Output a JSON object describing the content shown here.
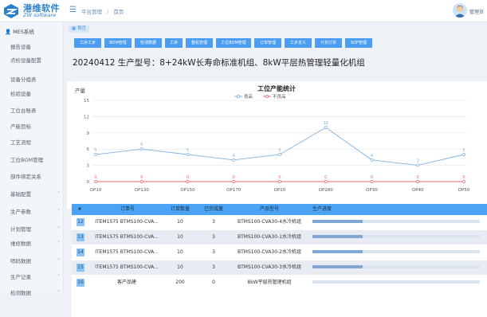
{
  "brand": {
    "name": "港维软件",
    "sub": "ZW software",
    "accent": "#2b7fd0"
  },
  "topbar": {
    "menu_icon": "menu-icon",
    "breadcrumbs": [
      "平台管理",
      "首页"
    ],
    "user_name": "管理员"
  },
  "sidebar": {
    "header": "MES系统",
    "items": [
      {
        "label": "报告设备",
        "expandable": false
      },
      {
        "label": "点检设备配置",
        "expandable": false
      },
      {
        "label": "设备分组表",
        "expandable": false
      },
      {
        "label": "检验设备",
        "expandable": false
      },
      {
        "label": "工位台账表",
        "expandable": false
      },
      {
        "label": "产能目标",
        "expandable": false
      },
      {
        "label": "工艺流程",
        "expandable": false
      },
      {
        "label": "工位BOM管理",
        "expandable": false
      },
      {
        "label": "部件绑定关系",
        "expandable": false
      },
      {
        "label": "基础配置",
        "expandable": true
      },
      {
        "label": "生产参数",
        "expandable": true
      },
      {
        "label": "计划管理",
        "expandable": true
      },
      {
        "label": "维修数据",
        "expandable": true
      },
      {
        "label": "喷码数据",
        "expandable": true
      },
      {
        "label": "生产记录",
        "expandable": true
      },
      {
        "label": "检测数据",
        "expandable": true
      }
    ]
  },
  "main": {
    "tab_tag": "首页",
    "buttons": [
      "工序工步",
      "BOM管理",
      "检测数据",
      "工序",
      "整机管理",
      "工位BOM管理",
      "订单管理",
      "工步定义",
      "计划订单",
      "SOP管理"
    ],
    "title": "20240412 生产型号：8+24kW长寿命标准机组、8kW平层热管理轻量化机组"
  },
  "chart_data": {
    "type": "line",
    "title": "工位产能统计",
    "ylabel": "产量",
    "xlabel": "",
    "ylim": [
      0,
      15
    ],
    "yticks": [
      0,
      3,
      6,
      9,
      12,
      15
    ],
    "categories": [
      "OP10",
      "OP130",
      "OP150",
      "OP170",
      "OP20",
      "OP280",
      "OP30",
      "OP40",
      "OP50"
    ],
    "series": [
      {
        "name": "良品",
        "color": "#7fb3e0",
        "values": [
          5,
          6,
          5,
          4,
          5,
          10,
          4,
          3,
          5
        ]
      },
      {
        "name": "不良品",
        "color": "#e86a6a",
        "values": [
          0,
          0,
          0,
          0,
          0,
          0,
          0,
          0,
          0
        ]
      }
    ],
    "legend": "top-center",
    "grid": true
  },
  "table": {
    "headers": [
      "#",
      "订单号",
      "订单数量",
      "已完成量",
      "产品型号",
      "生产进度"
    ],
    "rows": [
      {
        "idx": "12",
        "order": "ITEM1575 BTMS100-CVA...",
        "qty": "10",
        "done": "3",
        "model": "BTMS100-CVA30-4水冷机组",
        "progress": 0.3
      },
      {
        "idx": "13",
        "order": "ITEM1575 BTMS100-CVA...",
        "qty": "10",
        "done": "3",
        "model": "BTMS100-CVA30-1水冷机组",
        "progress": 0.3
      },
      {
        "idx": "14",
        "order": "ITEM1575 BTMS100-CVA...",
        "qty": "10",
        "done": "3",
        "model": "BTMS100-CVA30-2水冷机组",
        "progress": 0.3
      },
      {
        "idx": "15",
        "order": "ITEM1575 BTMS100-CVA...",
        "qty": "10",
        "done": "3",
        "model": "BTMS100-CVA30-3水冷机组",
        "progress": 0.3
      },
      {
        "idx": "16",
        "order": "客产品建",
        "qty": "200",
        "done": "0",
        "model": "8kW平层热管理机组",
        "progress": 0
      }
    ]
  }
}
